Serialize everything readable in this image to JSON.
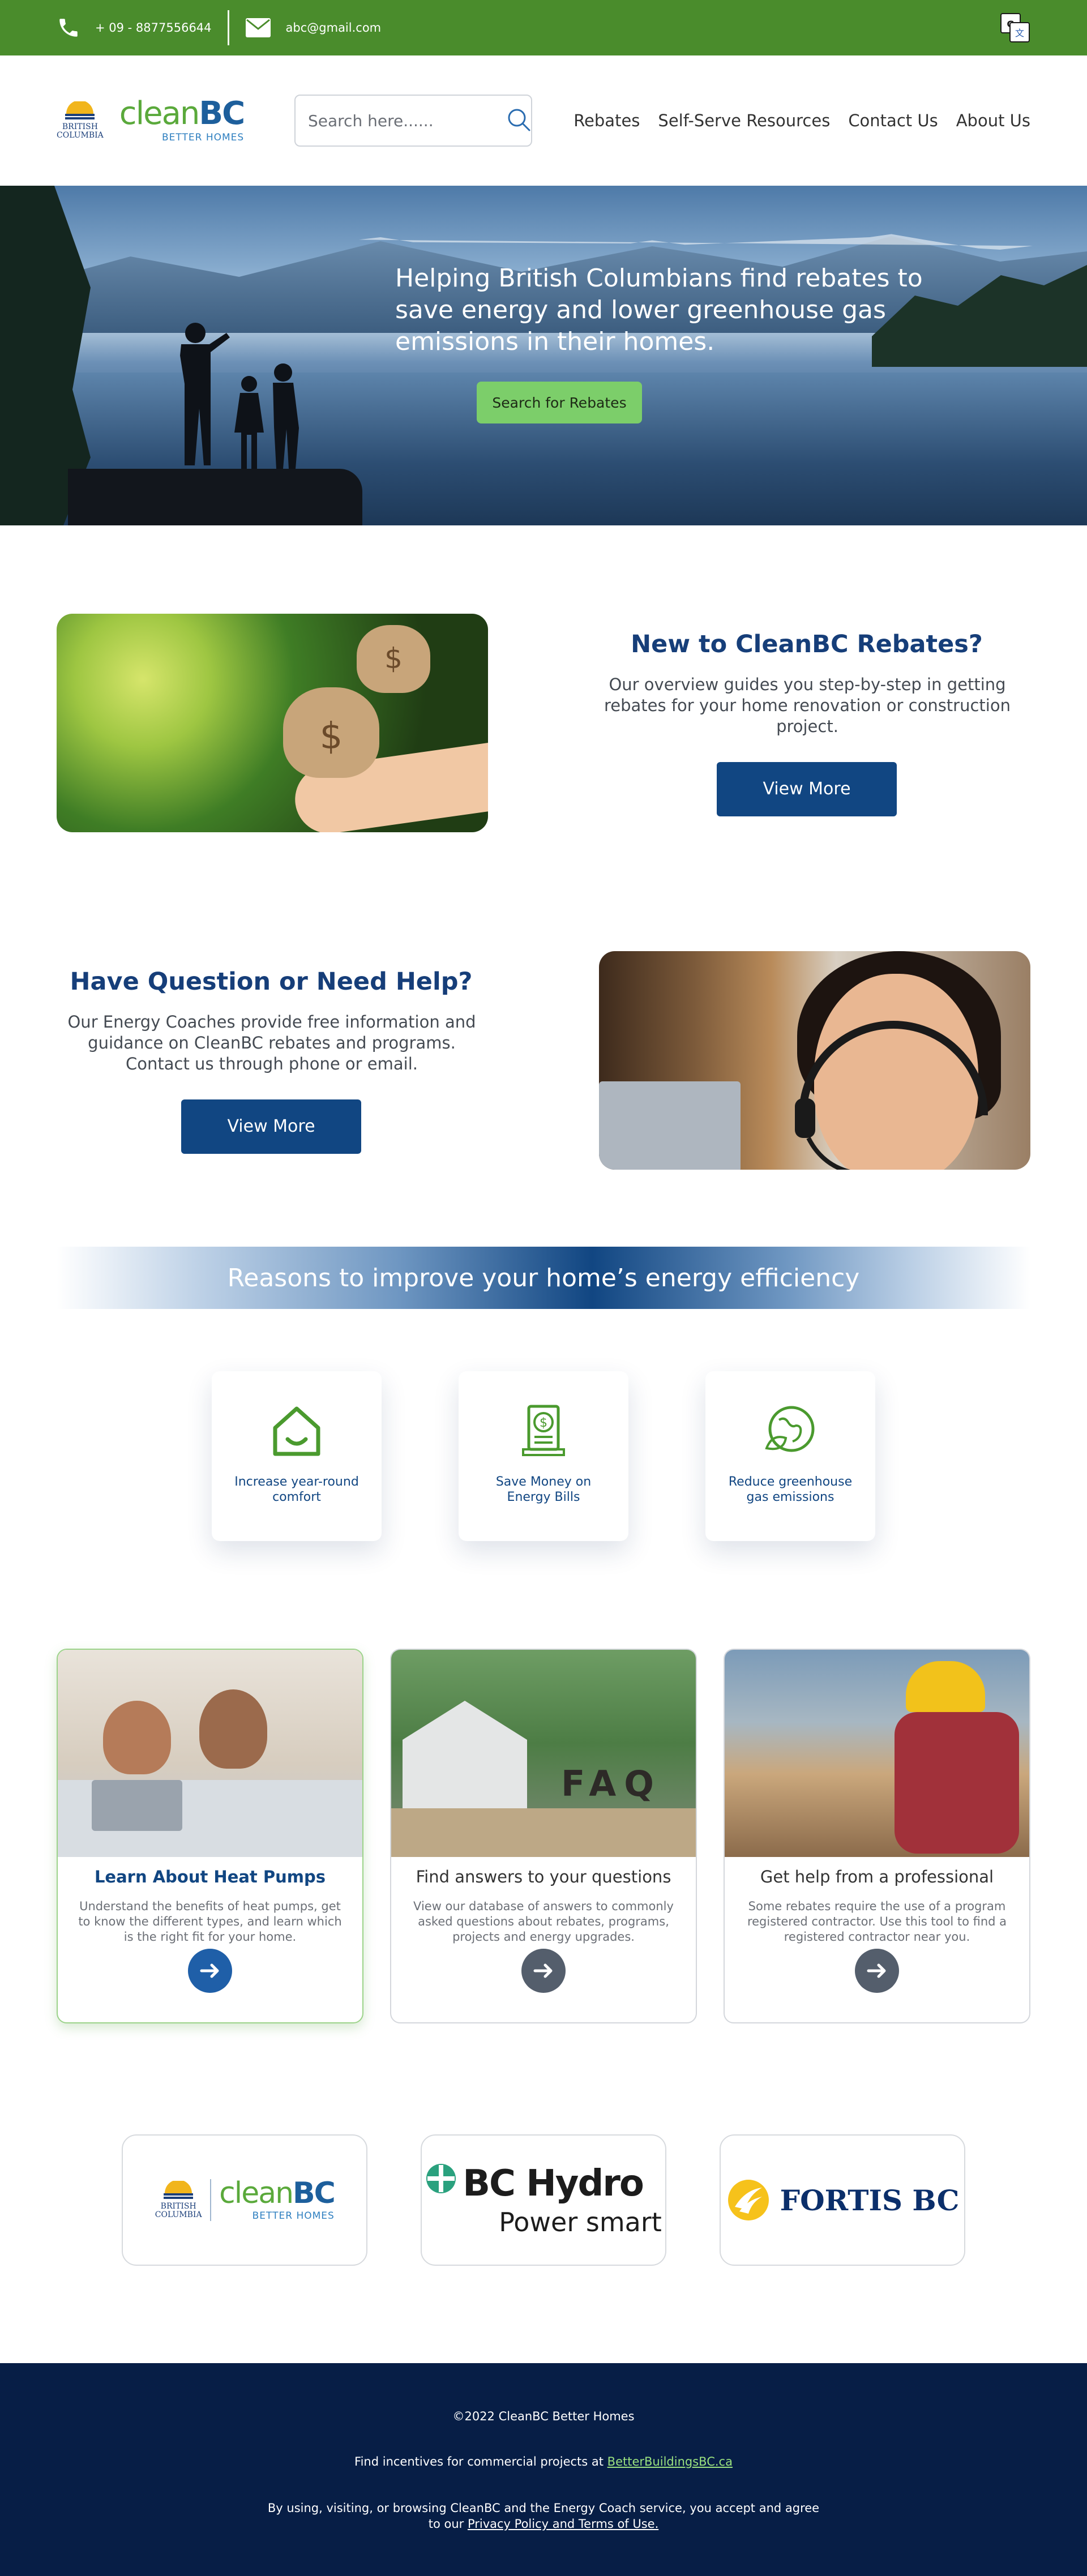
{
  "topbar": {
    "phone": "+ 09 - 8877556644",
    "email": "abc@gmail.com",
    "translate_icon": "translate-icon"
  },
  "header": {
    "logo_bc_line1": "BRITISH",
    "logo_bc_line2": "COLUMBIA",
    "logo_clean": "clean",
    "logo_bc": "BC",
    "logo_sub": "BETTER HOMES",
    "search_placeholder": "Search here......",
    "nav": [
      "Rebates",
      "Self-Serve Resources",
      "Contact Us",
      "About Us"
    ]
  },
  "hero": {
    "title": "Helping British Columbians find rebates to save energy and lower greenhouse gas emissions in their homes.",
    "cta": "Search for Rebates"
  },
  "feature1": {
    "title": "New to CleanBC Rebates?",
    "text": "Our overview guides you step-by-step in getting rebates for your home renovation or construction project.",
    "button": "View More"
  },
  "feature2": {
    "title": "Have Question or Need Help?",
    "text": "Our Energy Coaches provide free information and guidance on CleanBC rebates and programs. Contact us through phone or email.",
    "button": "View More"
  },
  "reasons": {
    "title": "Reasons to improve your home’s energy efficiency",
    "items": [
      {
        "label": "Increase year-round comfort",
        "icon": "home-smile-icon"
      },
      {
        "label": "Save Money on Energy Bills",
        "icon": "dollar-bill-icon"
      },
      {
        "label": "Reduce greenhouse gas emissions",
        "icon": "earth-leaf-icon"
      }
    ]
  },
  "resources": [
    {
      "title": "Learn About Heat Pumps",
      "text": "Understand the benefits of heat pumps, get to know the different types, and learn which is the right fit for your home."
    },
    {
      "title": "Find answers to your questions",
      "text": "View our database of answers to commonly asked questions about rebates, programs, projects and energy upgrades.",
      "photo_text": "FAQ"
    },
    {
      "title": "Get help from a professional",
      "text": "Some rebates require the use of a program registered contractor.  Use this tool to find a registered contractor near you."
    }
  ],
  "partners": {
    "cleanbc_line1": "BRITISH",
    "cleanbc_line2": "COLUMBIA",
    "cleanbc_clean": "clean",
    "cleanbc_bc": "BC",
    "cleanbc_sub": "BETTER HOMES",
    "bchydro_name": "BC Hydro",
    "bchydro_tag": "Power smart",
    "fortis": "FORTIS BC"
  },
  "footer": {
    "copyright": "©2022 CleanBC Better Homes",
    "commercial_prefix": "Find incentives for commercial projects at ",
    "commercial_link": "BetterBuildingsBC.ca",
    "legal_prefix": "By using, visiting, or browsing CleanBC and the Energy Coach service, you accept and agree to our ",
    "legal_link": "Privacy Policy and Terms of Use."
  },
  "colors": {
    "topbar": "#4a8c2c",
    "primary": "#114682",
    "accent_green": "#7cce6a",
    "footer": "#071e46"
  }
}
